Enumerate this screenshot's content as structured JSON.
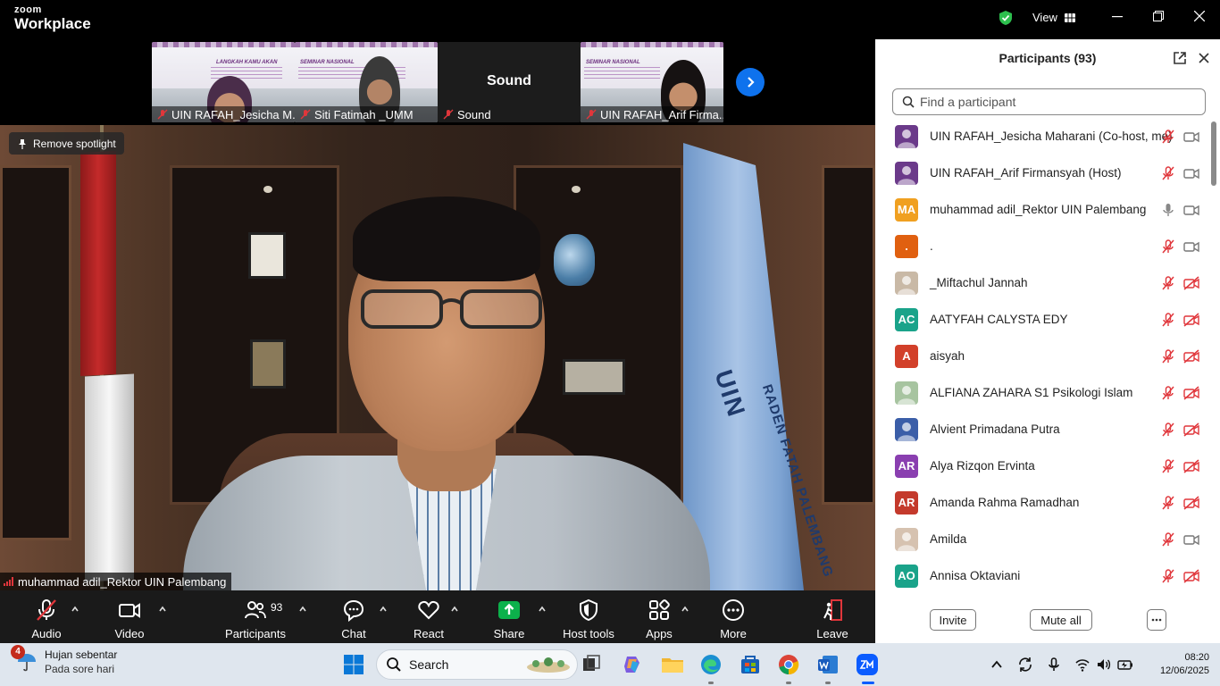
{
  "app": {
    "brand_line1": "zoom",
    "brand_line2": "Workplace",
    "view_label": "View"
  },
  "thumbnails": [
    {
      "name": "UIN RAFAH_Jesicha M...",
      "slide_text": "LANGKAH KAMU AKAN"
    },
    {
      "name": "Siti Fatimah _UMM",
      "slide_text": "SEMINAR NASIONAL"
    },
    {
      "name": "Sound",
      "center_name": "Sound"
    },
    {
      "name": "UIN RAFAH_Arif Firma...",
      "slide_text": "SEMINAR NASIONAL"
    }
  ],
  "main_video": {
    "speaker_name": "muhammad adil_Rektor UIN Palembang",
    "spotlight_label": "Remove spotlight",
    "flag_text_1": "UIN",
    "flag_text_2": "RADEN FATAH PALEMBANG"
  },
  "toolbar": {
    "audio": "Audio",
    "video": "Video",
    "participants": "Participants",
    "participants_count": "93",
    "chat": "Chat",
    "react": "React",
    "share": "Share",
    "host_tools": "Host tools",
    "apps": "Apps",
    "more": "More",
    "leave": "Leave"
  },
  "panel": {
    "title": "Participants (93)",
    "search_placeholder": "Find a participant",
    "invite": "Invite",
    "mute_all": "Mute all",
    "participants": [
      {
        "name": "UIN RAFAH_Jesicha Maharani (Co-host, me)",
        "initials": "",
        "color": "#6b3a8a",
        "mic": "muted",
        "cam": "on"
      },
      {
        "name": "UIN RAFAH_Arif Firmansyah (Host)",
        "initials": "",
        "color": "#6b3a8a",
        "mic": "muted",
        "cam": "on"
      },
      {
        "name": "muhammad adil_Rektor UIN Palembang",
        "initials": "MA",
        "color": "#f0a020",
        "mic": "active",
        "cam": "on"
      },
      {
        "name": ".",
        "initials": ".",
        "color": "#e06010",
        "mic": "muted",
        "cam": "on"
      },
      {
        "name": "_Miftachul Jannah",
        "initials": "",
        "color": "#c9b9a6",
        "mic": "muted",
        "cam": "off"
      },
      {
        "name": "AATYFAH CALYSTA EDY",
        "initials": "AC",
        "color": "#1aa38a",
        "mic": "muted",
        "cam": "off"
      },
      {
        "name": "aisyah",
        "initials": "A",
        "color": "#d2402a",
        "mic": "muted",
        "cam": "off"
      },
      {
        "name": "ALFIANA ZAHARA S1 Psikologi Islam",
        "initials": "",
        "color": "#a7c4a0",
        "mic": "muted",
        "cam": "off"
      },
      {
        "name": "Alvient Primadana Putra",
        "initials": "",
        "color": "#3b5ea8",
        "mic": "muted",
        "cam": "off"
      },
      {
        "name": "Alya Rizqon Ervinta",
        "initials": "AR",
        "color": "#8a3fb0",
        "mic": "muted",
        "cam": "off"
      },
      {
        "name": "Amanda Rahma Ramadhan",
        "initials": "AR",
        "color": "#c43a2c",
        "mic": "muted",
        "cam": "off"
      },
      {
        "name": "Amilda",
        "initials": "",
        "color": "#d6c2b0",
        "mic": "muted",
        "cam": "on"
      },
      {
        "name": "Annisa Oktaviani",
        "initials": "AO",
        "color": "#1aa38a",
        "mic": "muted",
        "cam": "off"
      }
    ]
  },
  "taskbar": {
    "weather_badge": "4",
    "weather_title": "Hujan sebentar",
    "weather_sub": "Pada sore hari",
    "search_label": "Search",
    "time": "08:20",
    "date": "12/06/2025"
  },
  "colors": {
    "accent_blue": "#0e72ed",
    "muted_red": "#e0363b",
    "share_green": "#0cb14b",
    "shield_green": "#2dbf4e"
  }
}
